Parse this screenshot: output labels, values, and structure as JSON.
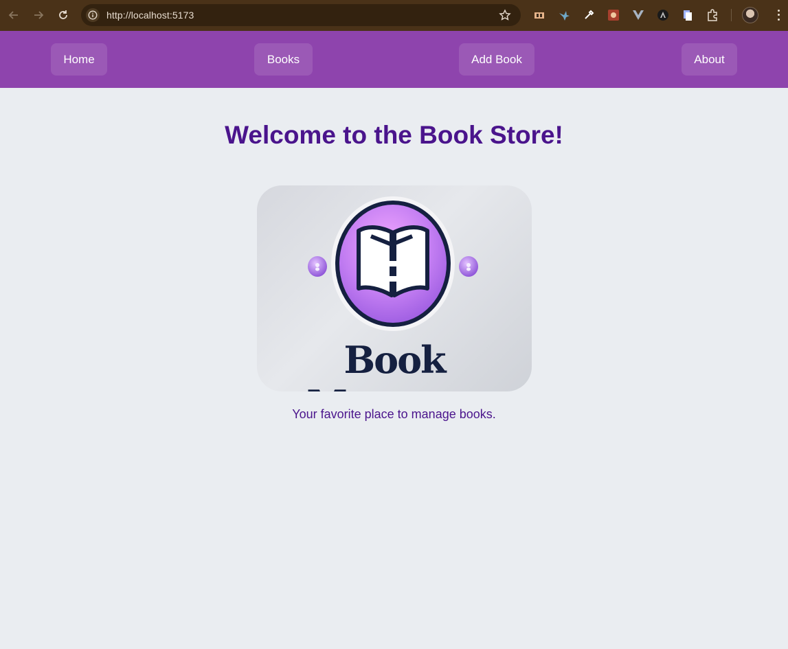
{
  "browser": {
    "url": "http://localhost:5173"
  },
  "nav": {
    "items": [
      {
        "label": "Home"
      },
      {
        "label": "Books"
      },
      {
        "label": "Add Book"
      },
      {
        "label": "About"
      }
    ]
  },
  "main": {
    "title": "Welcome to the Book Store!",
    "logo_text": "Book Manager",
    "tagline": "Your favorite place to manage books."
  },
  "colors": {
    "nav_bg": "#8e44ad",
    "nav_link_bg": "#9b59b6",
    "title": "#4a148c",
    "page_bg": "#eaedf1"
  }
}
